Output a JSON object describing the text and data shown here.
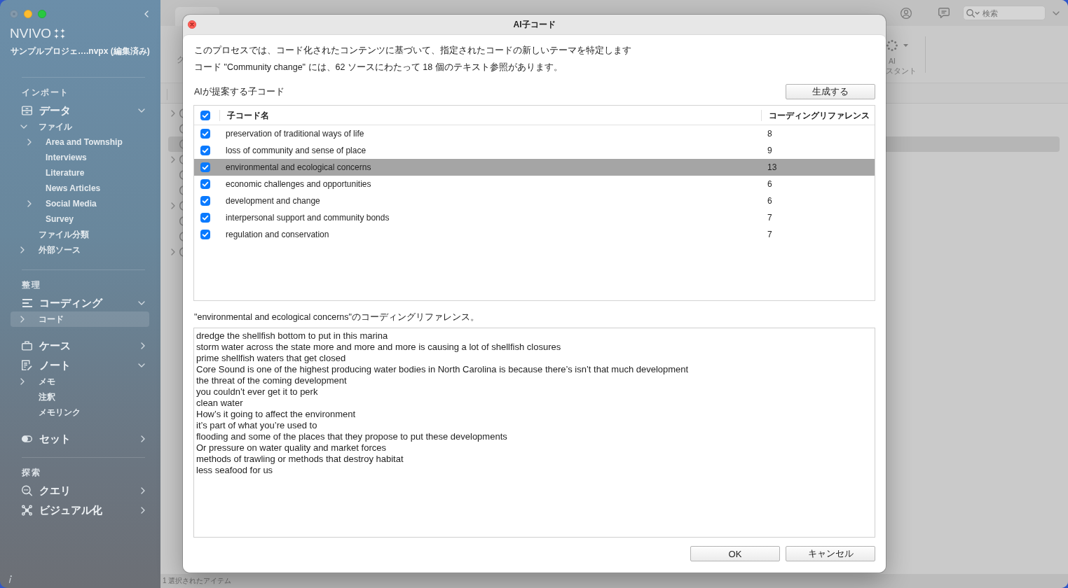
{
  "sidebar": {
    "logo": "NVIVO",
    "project": "サンプルプロジェ….nvpx (編集済み)",
    "sections": [
      {
        "heading": "インポート",
        "groups": [
          {
            "label": "データ",
            "expanded": true,
            "selected": false,
            "children": [
              {
                "label": "ファイル",
                "expanded": true,
                "selected": false,
                "children": [
                  {
                    "label": "Area and Township",
                    "expanded": false,
                    "selected": false
                  },
                  {
                    "label": "Interviews",
                    "selected": false
                  },
                  {
                    "label": "Literature",
                    "selected": false
                  },
                  {
                    "label": "News Articles",
                    "selected": false
                  },
                  {
                    "label": "Social Media",
                    "expanded": false,
                    "selected": false
                  },
                  {
                    "label": "Survey",
                    "selected": false
                  }
                ]
              },
              {
                "label": "ファイル分類",
                "selected": false
              },
              {
                "label": "外部ソース",
                "expanded": false,
                "selected": false
              }
            ]
          }
        ]
      },
      {
        "heading": "整理",
        "groups": [
          {
            "label": "コーディング",
            "expanded": true,
            "selected": false,
            "children": [
              {
                "label": "コード",
                "expanded": false,
                "selected": true
              }
            ]
          },
          {
            "label": "ケース",
            "expanded": false,
            "selected": false
          },
          {
            "label": "ノート",
            "expanded": true,
            "selected": false,
            "children": [
              {
                "label": "メモ",
                "expanded": false,
                "selected": false
              },
              {
                "label": "注釈",
                "selected": false
              },
              {
                "label": "メモリンク",
                "selected": false
              }
            ]
          },
          {
            "label": "セット",
            "expanded": false,
            "selected": false
          }
        ]
      },
      {
        "heading": "探索",
        "groups": [
          {
            "label": "クエリ",
            "expanded": false,
            "selected": false
          },
          {
            "label": "ビジュアル化",
            "expanded": false,
            "selected": false
          }
        ]
      }
    ]
  },
  "toolbar": {
    "partial_label": "ク",
    "ai_button": {
      "lines": [
        "AI",
        "スタント"
      ]
    },
    "search": {
      "placeholder": "検索"
    }
  },
  "tree": {
    "rows": [
      {
        "expanded": false,
        "selected": false
      },
      {
        "selected": false
      },
      {
        "selected": true
      },
      {
        "expanded": false,
        "selected": false
      },
      {
        "selected": false
      },
      {
        "selected": false
      },
      {
        "expanded": false,
        "selected": false
      },
      {
        "selected": false
      },
      {
        "selected": false
      },
      {
        "expanded": false,
        "selected": false
      }
    ]
  },
  "dialog": {
    "title": "AI子コード",
    "intro": [
      "このプロセスでは、コード化されたコンテンツに基づいて、指定されたコードの新しいテーマを特定します",
      "コード \"Community change\" には、62 ソースにわたって 18 個のテキスト参照があります。"
    ],
    "suggestions_label": "AIが提案する子コード",
    "generate_button": "生成する",
    "table": {
      "all_checked": true,
      "columns": [
        "子コード名",
        "コーディングリファレンス"
      ],
      "rows": [
        {
          "name": "preservation of traditional ways of life",
          "references": "8",
          "checked": true,
          "selected": false
        },
        {
          "name": "loss of community and sense of place",
          "references": "9",
          "checked": true,
          "selected": false
        },
        {
          "name": "environmental and ecological concerns",
          "references": "13",
          "checked": true,
          "selected": true
        },
        {
          "name": "economic challenges and opportunities",
          "references": "6",
          "checked": true,
          "selected": false
        },
        {
          "name": "development and change",
          "references": "6",
          "checked": true,
          "selected": false
        },
        {
          "name": "interpersonal support and community bonds",
          "references": "7",
          "checked": true,
          "selected": false
        },
        {
          "name": "regulation and conservation",
          "references": "7",
          "checked": true,
          "selected": false
        }
      ]
    },
    "references_label": "\"environmental and ecological concerns\"のコーディングリファレンス。",
    "references": [
      "dredge the shellfish bottom to put in this marina",
      "storm water across the state more and more and more is causing a lot of shellfish closures",
      "prime shellfish waters that get closed",
      "Core Sound is one of the highest producing water bodies in North Carolina is because there’s isn’t that much development",
      "the threat of the coming development",
      "you couldn’t ever get it to perk",
      "clean water",
      "How’s it going to affect the environment",
      "it’s part of what you’re used to",
      "flooding and some of the places that they propose to put these developments",
      "Or pressure on water quality and market forces",
      "methods of trawling or methods that destroy habitat",
      "less seafood for us"
    ],
    "buttons": [
      "OK",
      "キャンセル"
    ]
  },
  "status_bar": "1 選択されたアイテム"
}
